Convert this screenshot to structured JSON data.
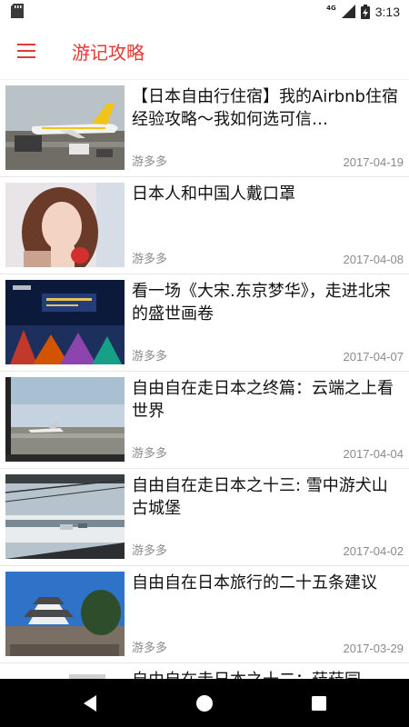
{
  "status_bar": {
    "time": "3:13",
    "network": "4G"
  },
  "app_bar": {
    "title": "游记攻略"
  },
  "articles": [
    {
      "title": "【日本自由行住宿】我的Airbnb住宿经验攻略～我如何选可信…",
      "author": "游多多",
      "date": "2017-04-19"
    },
    {
      "title": "日本人和中国人戴口罩",
      "author": "游多多",
      "date": "2017-04-08"
    },
    {
      "title": "看一场《大宋.东京梦华》，走进北宋的盛世画卷",
      "author": "游多多",
      "date": "2017-04-07"
    },
    {
      "title": "自由自在走日本之终篇：云端之上看世界",
      "author": "游多多",
      "date": "2017-04-04"
    },
    {
      "title": "自由自在走日本之十三: 雪中游犬山古城堡",
      "author": "游多多",
      "date": "2017-04-02"
    },
    {
      "title": "自由自在日本旅行的二十五条建议",
      "author": "游多多",
      "date": "2017-03-29"
    },
    {
      "title": "自由自在走日本之十二：菈菈园",
      "author": "",
      "date": ""
    }
  ],
  "colors": {
    "accent": "#e53935",
    "text": "#111111",
    "meta": "#8a8a8a"
  },
  "icons": [
    "sd-card-icon",
    "signal-icon",
    "battery-charging-icon",
    "menu-icon",
    "back-icon",
    "home-icon",
    "recents-icon"
  ]
}
